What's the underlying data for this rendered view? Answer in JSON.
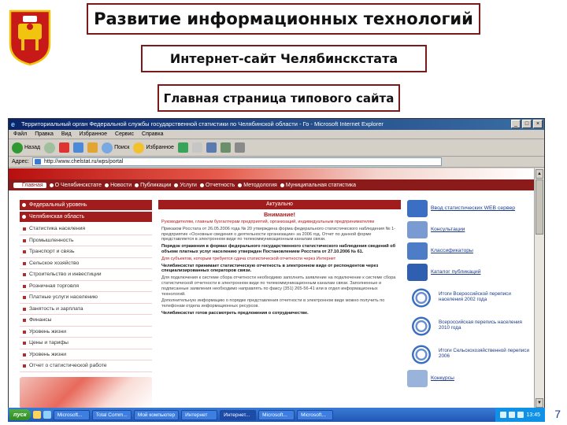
{
  "slide": {
    "title": "Развитие информационных технологий",
    "subtitle": "Интернет-сайт Челябинскстата",
    "section": "Главная страница типового сайта",
    "page_number": "7"
  },
  "browser": {
    "window_title": "Территориальный орган Федеральной службы государственной статистики по Челябинской области - Го - Microsoft Internet Explorer",
    "menu": [
      "Файл",
      "Правка",
      "Вид",
      "Избранное",
      "Сервис",
      "Справка"
    ],
    "toolbar": {
      "back": "Назад",
      "search": "Поиск",
      "favorites": "Избранное"
    },
    "address_label": "Адрес:",
    "address": "http://www.chelstat.ru/wps/portal"
  },
  "site": {
    "nav": [
      {
        "label": "Главная",
        "active": true
      },
      {
        "label": "О Челябинскстате"
      },
      {
        "label": "Новости"
      },
      {
        "label": "Публикации"
      },
      {
        "label": "Услуги"
      },
      {
        "label": "Отчетность"
      },
      {
        "label": "Методология"
      },
      {
        "label": "Муниципальная статистика"
      }
    ],
    "left_head1": "Федеральный уровень",
    "left_head2": "Челябинская область",
    "left_items": [
      "Статистика населения",
      "Промышленность",
      "Транспорт и связь",
      "Сельское хозяйство",
      "Строительство и инвестиции",
      "Розничная торговля",
      "Платные услуги населению",
      "Занятость и зарплата",
      "Финансы",
      "Уровень жизни",
      "Цены и тарифы",
      "Уровень жизни",
      "Отчет о статистической работе"
    ],
    "center_head": "Актуально",
    "center_sub": "Внимание!",
    "center_paragraphs": [
      {
        "cls": "red",
        "text": "Руководителям, главным бухгалтерам предприятий, организаций, индивидуальным предпринимателям"
      },
      {
        "cls": "",
        "text": "Приказом Росстата от 26.05.2006 года № 20 утверждена форма федерального статистического наблюдения № 1-предприятие «Основные сведения о деятельности организации» за 2006 год. Отчет по данной форме представляется в электронном виде по телекоммуникационным каналам связи."
      },
      {
        "cls": "bold",
        "text": "Порядок отражения в формах федерального государственного статистического наблюдения сведений об объеме платных услуг населению утвержден Постановлением Росстата от 27.10.2006 № 61."
      },
      {
        "cls": "red",
        "text": "Для субъектов, которым требуется сдача статистической отчетности через Интернет"
      },
      {
        "cls": "bold",
        "text": "Челябинскстат принимает статистическую отчетность в электронном виде от респондентов через специализированных операторов связи."
      },
      {
        "cls": "",
        "text": "Для подключения к системе сбора отчетности необходимо заполнить заявление на подключение к системе сбора статистической отчетности в электронном виде по телекоммуникационным каналам связи. Заполненные и подписанные заявления необходимо направлять по факсу (351) 265-56-41 или в отдел информационных технологий."
      },
      {
        "cls": "",
        "text": "Дополнительную информацию о порядке представления отчетности в электронном виде можно получить по телефонам отдела информационных ресурсов."
      },
      {
        "cls": "bold",
        "text": "Челябинскстат готов рассмотреть предложения о сотрудничестве."
      }
    ],
    "right_items": [
      {
        "label": "Ввод статистических WEB сервер",
        "color": "#3b6fc4"
      },
      {
        "label": "Консультации",
        "color": "#7a9bd2"
      },
      {
        "label": "Классификаторы",
        "color": "#4c7dc6"
      },
      {
        "label": "Каталог публикаций",
        "color": "#2e5fb0"
      }
    ],
    "census": [
      {
        "label": "Итоги Всероссийской переписи населения 2002 года"
      },
      {
        "label": "Всероссийская перепись населения 2010 года"
      },
      {
        "label": "Итоги Сельскохозяйственной переписи 2006"
      }
    ],
    "right_last": "Конкурсы"
  },
  "taskbar": {
    "start": "пуск",
    "tasks": [
      "Microsoft...",
      "Total Comm...",
      "Мой компьютер",
      "Интернет",
      "Интернет...",
      "Microsoft...",
      "Microsoft..."
    ],
    "time": "13:45"
  },
  "colors": {
    "frame": "#7a1a1a",
    "site_red": "#a11c1c",
    "link_blue": "#1a3a8a"
  }
}
